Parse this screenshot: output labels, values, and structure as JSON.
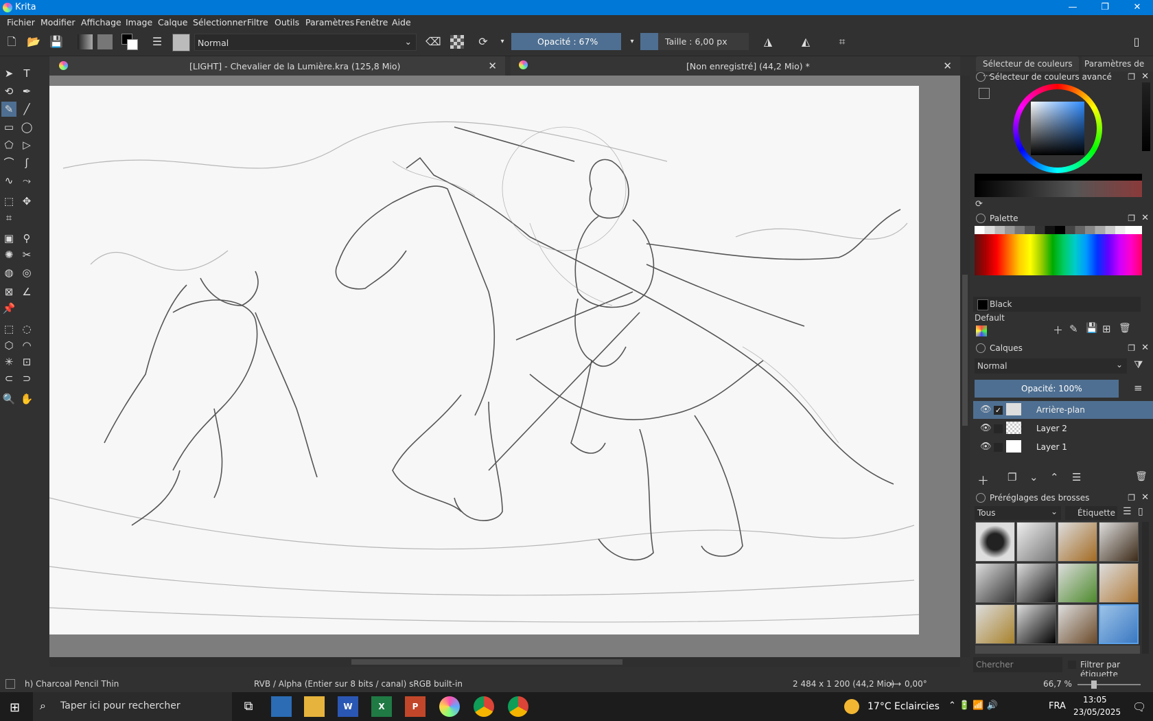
{
  "window": {
    "title": "Krita"
  },
  "menubar": [
    "Fichier",
    "Modifier",
    "Affichage",
    "Image",
    "Calque",
    "Sélectionner",
    "Filtre",
    "Outils",
    "Paramètres",
    "Fenêtre",
    "Aide"
  ],
  "toolbar": {
    "blend_mode": "Normal",
    "opacity_label": "Opacité : 67%",
    "opacity_value": 0.67,
    "size_label": "Taille :  6,00 px"
  },
  "tabs": [
    {
      "label": "[LIGHT] - Chevalier de la Lumière.kra (125,8 Mio)"
    },
    {
      "label": "[Non enregistré]  (44,2 Mio) *"
    }
  ],
  "dockers": {
    "color_tabs": [
      "Sélecteur de couleurs ...",
      "Paramètres de ..."
    ],
    "color_selector": {
      "title": "Sélecteur de couleurs avancé"
    },
    "palette": {
      "title": "Palette",
      "current_color": "Black",
      "current_color_hex": "#000000",
      "set_name": "Default"
    },
    "layers": {
      "title": "Calques",
      "blend_mode": "Normal",
      "opacity_label": "Opacité:  100%",
      "items": [
        {
          "name": "Arrière-plan",
          "selected": true
        },
        {
          "name": "Layer 2",
          "selected": false
        },
        {
          "name": "Layer 1",
          "selected": false
        }
      ]
    },
    "brushes": {
      "title": "Préréglages des brosses",
      "filter": "Tous",
      "tag_button": "Étiquette",
      "search_placeholder": "Chercher",
      "filter_by_tag": "Filtrer par étiquette"
    }
  },
  "statusbar": {
    "brush_name": "h) Charcoal Pencil Thin",
    "color_profile": "RVB / Alpha (Entier sur 8 bits / canal) sRGB built-in",
    "image_size": "2 484 x 1 200 (44,2 Mio)",
    "rotation": "0,00°",
    "zoom": "66,7 %"
  },
  "taskbar": {
    "search_placeholder": "Taper ici pour rechercher",
    "weather": "17°C  Eclaircies",
    "lang": "FRA",
    "time": "13:05",
    "date": "23/05/2025"
  },
  "colors": {
    "accent": "#0078d7",
    "selection": "#4e6f91",
    "panel": "#313131"
  }
}
